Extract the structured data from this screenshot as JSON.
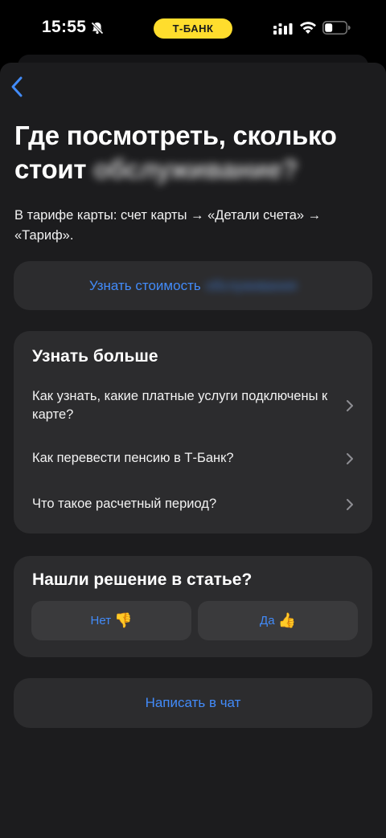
{
  "status_bar": {
    "time": "15:55",
    "brand_label": "Т-БАНК",
    "icons": [
      "bell-slash-icon",
      "signal-icon",
      "wifi-icon",
      "battery-icon"
    ],
    "brand_color": "#ffdd2d"
  },
  "header": {
    "back_icon": "chevron-left-icon",
    "title": "Где посмотреть, сколько стоит",
    "title_obscured": "обслуживание?",
    "subtitle": "В тарифе карты: счет карты → «Детали счета» → «Тариф»."
  },
  "primary_action": {
    "label": "Узнать стоимость",
    "label_obscured": "обслуживания"
  },
  "learn_more": {
    "title": "Узнать больше",
    "items": [
      {
        "label": "Как узнать, какие платные услуги подключены к карте?"
      },
      {
        "label": "Как перевести пенсию в Т-Банк?"
      },
      {
        "label": "Что такое расчетный период?"
      }
    ]
  },
  "feedback": {
    "title": "Нашли решение в статье?",
    "no_label": "Нет",
    "no_emoji": "👎",
    "yes_label": "Да",
    "yes_emoji": "👍"
  },
  "chat": {
    "label": "Написать в чат"
  },
  "colors": {
    "accent": "#428bf9",
    "background": "#000000",
    "sheet": "#1c1c1e",
    "card": "#2c2c2e",
    "button": "#3a3a3c"
  }
}
